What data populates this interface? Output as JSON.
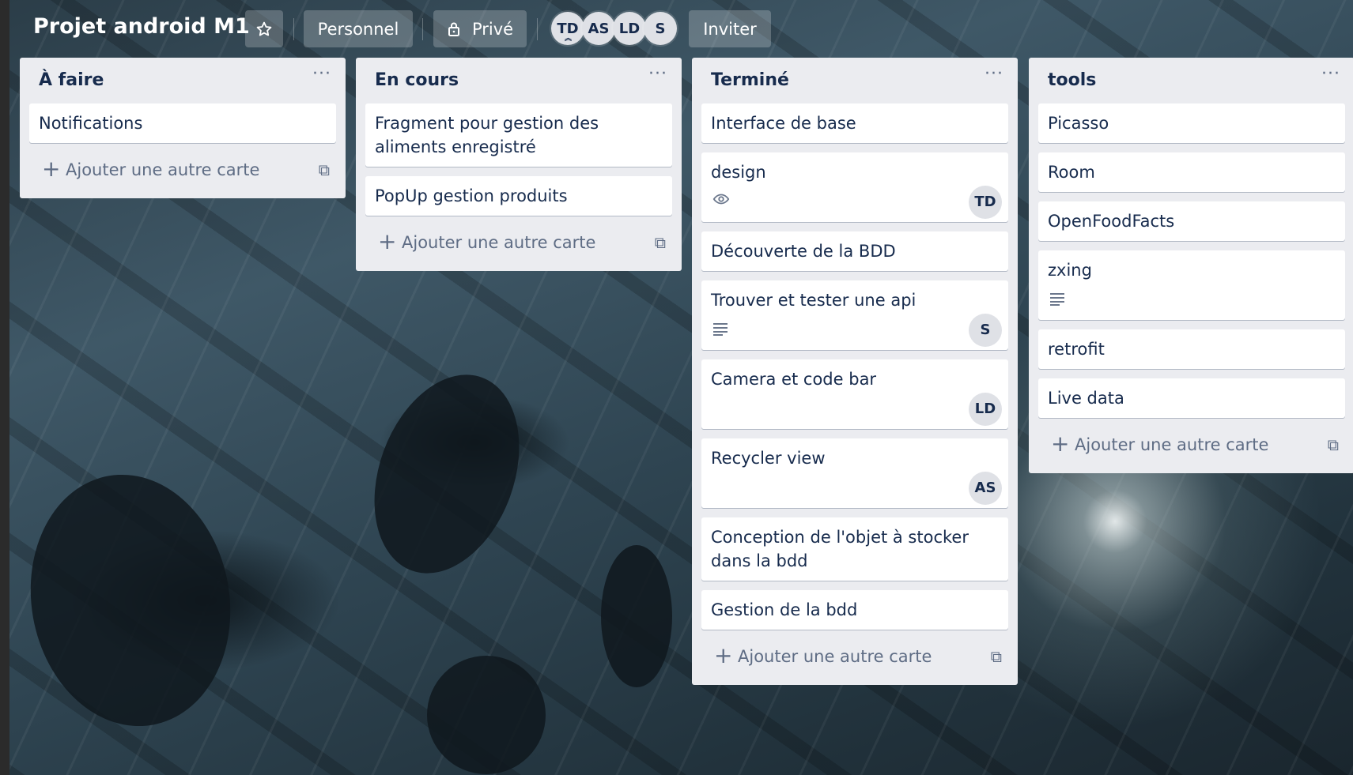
{
  "board": {
    "title": "Projet android M1",
    "workspace_label": "Personnel",
    "visibility_label": "Privé",
    "invite_label": "Inviter",
    "star_icon": "star-outline-icon",
    "lock_icon": "lock-icon",
    "members": [
      {
        "initials": "TD",
        "admin": true
      },
      {
        "initials": "AS"
      },
      {
        "initials": "LD"
      },
      {
        "initials": "S"
      }
    ]
  },
  "add_card_label": "Ajouter une autre carte",
  "lists": [
    {
      "title": "À faire",
      "cards": [
        {
          "title": "Notifications"
        }
      ]
    },
    {
      "title": "En cours",
      "cards": [
        {
          "title": "Fragment pour gestion des aliments enregistré"
        },
        {
          "title": "PopUp gestion produits"
        }
      ]
    },
    {
      "title": "Terminé",
      "cards": [
        {
          "title": "Interface de base"
        },
        {
          "title": "design",
          "badge": "eye-icon",
          "member": "TD"
        },
        {
          "title": "Découverte de la BDD"
        },
        {
          "title": "Trouver et tester une api",
          "badge": "description-icon",
          "member": "S"
        },
        {
          "title": "Camera et code bar",
          "member": "LD"
        },
        {
          "title": "Recycler view",
          "member": "AS"
        },
        {
          "title": "Conception de l'objet à stocker dans la bdd"
        },
        {
          "title": "Gestion de la bdd"
        }
      ]
    },
    {
      "title": "tools",
      "cards": [
        {
          "title": "Picasso"
        },
        {
          "title": "Room"
        },
        {
          "title": "OpenFoodFacts"
        },
        {
          "title": "zxing",
          "badge": "description-icon"
        },
        {
          "title": "retrofit"
        },
        {
          "title": "Live data"
        }
      ]
    }
  ]
}
